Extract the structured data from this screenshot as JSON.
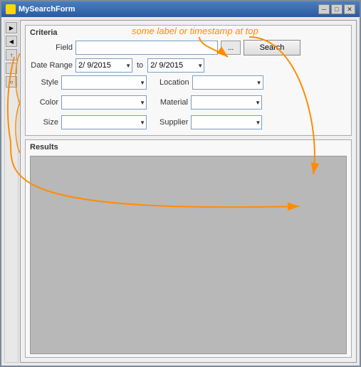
{
  "window": {
    "title": "MySearchForm",
    "title_icon": "form-icon",
    "buttons": {
      "minimize": "─",
      "maximize": "□",
      "close": "✕"
    }
  },
  "annotation": {
    "label": "some label or timestamp at top"
  },
  "criteria": {
    "section_label": "Criteria",
    "field_label": "Field",
    "field_placeholder": "",
    "browse_label": "...",
    "search_label": "Search",
    "date_range_label": "Date Range",
    "date_from": "2/ 9/2015",
    "date_to_connector": "to",
    "date_to": "2/ 9/2015",
    "style_label": "Style",
    "location_label": "Location",
    "color_label": "Color",
    "material_label": "Material",
    "size_label": "Size",
    "supplier_label": "Supplier"
  },
  "results": {
    "section_label": "Results"
  },
  "dropdowns": {
    "style_options": [
      ""
    ],
    "location_options": [
      ""
    ],
    "color_options": [
      ""
    ],
    "material_options": [
      ""
    ],
    "size_options": [
      ""
    ],
    "supplier_options": [
      ""
    ]
  }
}
